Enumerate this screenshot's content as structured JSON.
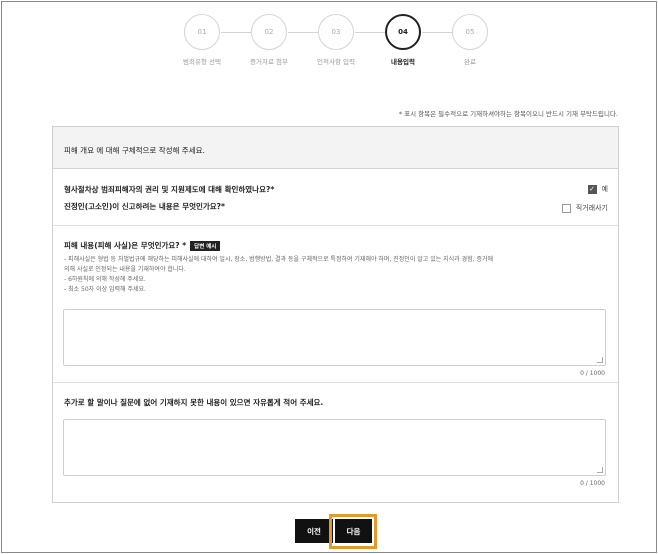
{
  "steps": [
    {
      "num": "01",
      "label": "범죄유형 선택"
    },
    {
      "num": "02",
      "label": "증거자료 첨부"
    },
    {
      "num": "03",
      "label": "인적사항 입력"
    },
    {
      "num": "04",
      "label": "내용입력"
    },
    {
      "num": "05",
      "label": "완료"
    }
  ],
  "active_step": "04",
  "notice": "* 표시 항목은 필수적으로 기재하셔야하는 항목이오니 반드시 기재 부탁드립니다.",
  "section_title": "피해 개요 에 대해 구체적으로 작성해 주세요.",
  "q1": {
    "text": "형사절차상 범죄피해자의 권리 및 지원제도에 대해 확인하였나요?*",
    "option": "예",
    "checked": true
  },
  "q2": {
    "text": "진정인(고소인)이 신고하려는 내용은 무엇인가요?*",
    "option": "직거래사기",
    "checked": false
  },
  "q3": {
    "text": "피해 내용(피해 사실)은 무엇인가요? *",
    "badge": "답변 예시",
    "help": [
      "- 피해사실은 형법 등 처벌법규에 해당하는 피해사실에 대하여 일시, 장소, 범행방법, 결과 등을 구체적으로 특정하여 기재해야 하며, 진정인이 알고 있는 지식과 경험, 증거에",
      "  의해 사실로 인정되는 내용을 기재하여야 합니다.",
      "- 6하원칙에 의해 작성해 주세요.",
      "- 최소 50자 이상 입력해 주세요."
    ],
    "count": "0 / 1000"
  },
  "q4": {
    "text": "추가로 할 말이나 질문에 없어 기재하지 못한 내용이 있으면 자유롭게 적어 주세요.",
    "count": "0 / 1000"
  },
  "buttons": {
    "prev": "이전",
    "next": "다음"
  },
  "colors": {
    "highlight": "#e39a2c",
    "button": "#111111"
  }
}
